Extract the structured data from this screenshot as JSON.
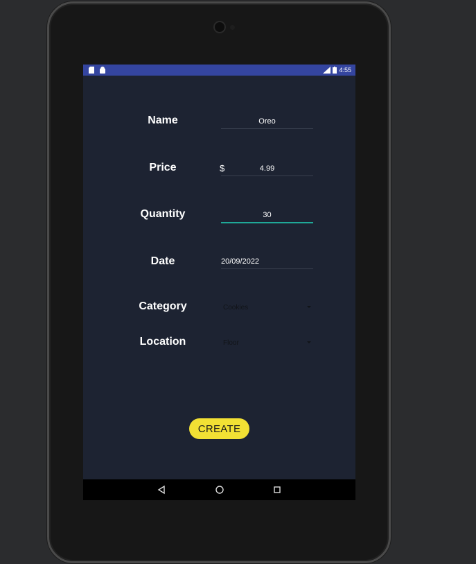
{
  "status_bar": {
    "time": "4:55",
    "left_icons": [
      "sd-card-icon",
      "android-icon"
    ],
    "right_icons": [
      "signal-icon",
      "battery-icon"
    ]
  },
  "form": {
    "name": {
      "label": "Name",
      "value": "Oreo"
    },
    "price": {
      "label": "Price",
      "currency": "$",
      "value": "4.99"
    },
    "quantity": {
      "label": "Quantity",
      "value": "30"
    },
    "date": {
      "label": "Date",
      "value": "20/09/2022"
    },
    "category": {
      "label": "Category",
      "selected": "Cookies"
    },
    "location": {
      "label": "Location",
      "selected": "Floor"
    }
  },
  "actions": {
    "create_label": "CREATE"
  },
  "nav": {
    "buttons": [
      "back-icon",
      "home-icon",
      "recents-icon"
    ]
  },
  "colors": {
    "screen_bg": "#1d2332",
    "status_bar": "#3445a0",
    "accent_button": "#f2e034",
    "focus_underline": "#1fa898"
  }
}
